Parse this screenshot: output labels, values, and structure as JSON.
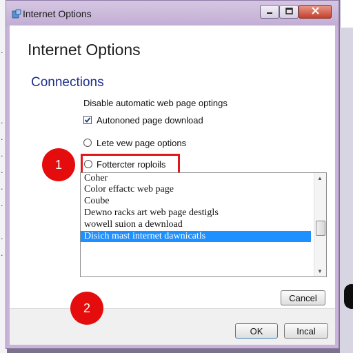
{
  "window": {
    "title": "Internet Options",
    "controls": {
      "minimize": "minimize-icon",
      "maximize": "maximize-icon",
      "close": "close-icon"
    }
  },
  "dialog": {
    "heading": "Internet Options",
    "section_title": "Connections",
    "description": "Disable automatic web page optings",
    "checkbox": {
      "label": "Autononed page download",
      "checked": true
    },
    "radio_1": {
      "label": "Lete vew page options",
      "selected": false
    },
    "radio_2": {
      "label": "Fottercter roploils",
      "selected": false
    },
    "list": {
      "items": [
        "Coher",
        "Color effactc web page",
        "Coube",
        "Dewno racks art web page destigls",
        "wowell suion a dewnload",
        "Disich mast internet dawnicatls"
      ],
      "selected_index": 5
    },
    "buttons": {
      "cancel": "Cancel",
      "ok": "OK",
      "second": "Incal"
    }
  },
  "annotations": {
    "marker_1": "1",
    "marker_2": "2"
  },
  "colors": {
    "accent_selection": "#1e90ff",
    "section_title": "#1e2e8a",
    "annotation_red": "#e40c0c",
    "window_frame": "#c8b4d8"
  }
}
